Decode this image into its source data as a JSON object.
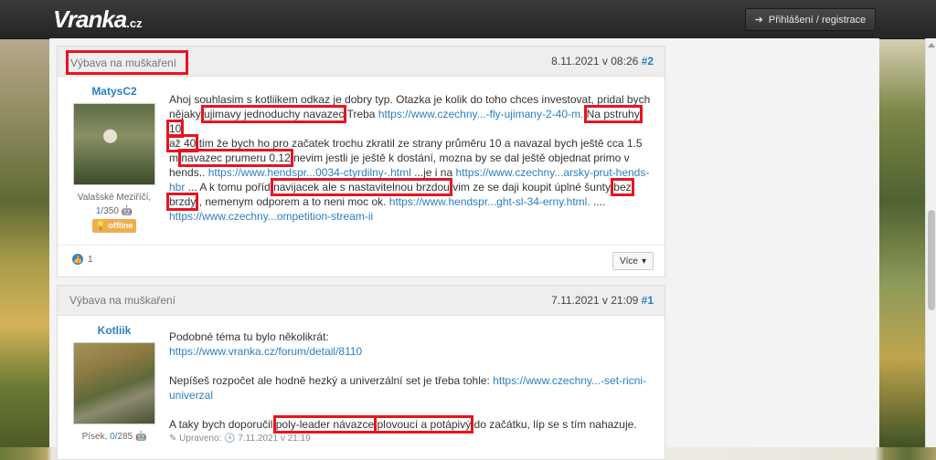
{
  "header": {
    "logo_main": "Vranka",
    "logo_tld": ".cz",
    "login_label": "Přihlášení / registrace"
  },
  "posts": [
    {
      "title": "Výbava na muškaření",
      "date": "8.11.2021 v 08:26",
      "num": "#2",
      "author": "MatysC2",
      "location": "Valašské Meziříčí,",
      "count_current": "1",
      "count_total": "/350",
      "status": "offline",
      "segments": [
        "Ahoj souhlasim s kotliikem odkaz je dobry typ. Otazka je kolik do toho chces investovat, pridal bych nějaky ",
        "ujimavy jednoduchy navazec",
        " Treba ",
        "https://www.czechny...-fly-ujimany-2-40-m.",
        " ",
        "Na pstruhy 10",
        "až 40",
        " tim že bych ho pro začatek trochu zkratil ze strany průměru 10 a navazal bych ještě cca 1.5 m ",
        "navazec prumeru 0.12",
        " nevim jestli je ještě k dostání, mozna by se dal ještě objednat primo v hends.. ",
        "https://www.hendspr...0034-ctyrdilny-.html",
        " ...je i na ",
        "https://www.czechny...arsky-prut-hends-hbr",
        " ... A k tomu poříd ",
        "navijacek ale s nastavitelnou brzdou",
        " vim ze se daji koupit úplné šunty ",
        "bez brzdy",
        " , nemenym odporem a to neni moc ok. ",
        "https://www.hendspr...ght-sl-34-erny.html.",
        " .... ",
        "https://www.czechny...ompetition-stream-ii"
      ],
      "likes": "1",
      "more_label": "Více"
    },
    {
      "title": "Výbava na muškaření",
      "date": "7.11.2021 v 21:09",
      "num": "#1",
      "author": "Kotliik",
      "location": "Písek,",
      "count_current": "0",
      "count_total": "/285",
      "p1": "Podobné téma tu bylo několikrát:",
      "p1_link": "https://www.vranka.cz/forum/detail/8110",
      "p2_text": "Nepíšeš rozpočet ale hodně hezký a univerzální set je třeba tohle: ",
      "p2_link": "https://www.czechny...-set-ricni-univerzal",
      "p3_a": "A taky bych doporučil ",
      "p3_hl1": "poly-leader návazce",
      "p3_b": " ",
      "p3_hl2": "plovoucí a potápivý",
      "p3_c": " do začátku, líp se s tím nahazuje.",
      "edited_label": "Upraveno:",
      "edited_date": "7.11.2021 v 21:19"
    }
  ]
}
